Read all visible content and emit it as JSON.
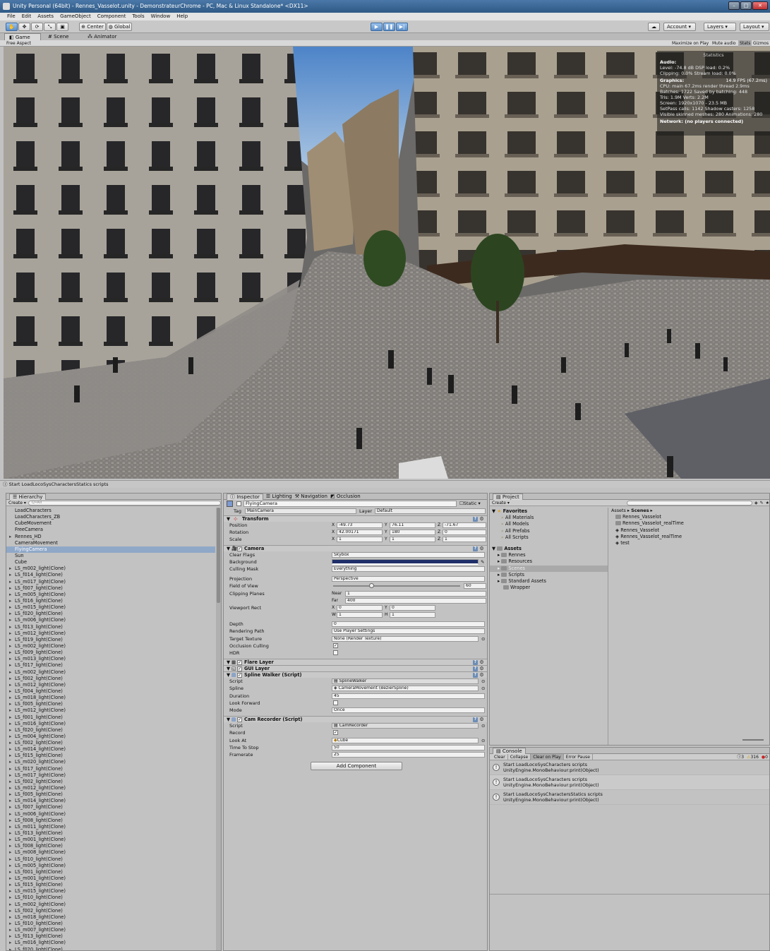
{
  "window": {
    "title": "Unity Personal (64bit) - Rennes_Vasselot.unity - DemonstrateurChrome - PC, Mac & Linux Standalone* <DX11>",
    "buttons": [
      "–",
      "□",
      "✕"
    ]
  },
  "menu": [
    "File",
    "Edit",
    "Assets",
    "GameObject",
    "Component",
    "Tools",
    "Window",
    "Help"
  ],
  "toolbar": {
    "center": "Center",
    "global": "Global",
    "account": "Account",
    "layers": "Layers",
    "layout": "Layout"
  },
  "view_tabs": {
    "game": "Game",
    "scene": "Scene",
    "animator": "Animator"
  },
  "game_bar": {
    "aspect": "Free Aspect",
    "maximize": "Maximize on Play",
    "mute": "Mute audio",
    "stats": "Stats",
    "gizmos": "Gizmos"
  },
  "stats": {
    "header": "Statistics",
    "audio_title": "Audio:",
    "audio_lines": [
      "Level: -74.8 dB        DSP load: 0.2%",
      "Clipping: 0.0%         Stream load: 0.0%"
    ],
    "graphics_title": "Graphics:",
    "fps": "14.9 FPS (67.2ms)",
    "graphics_lines": [
      "CPU: main 67.2ms  render thread 2.9ms",
      "Batches: 1722     Saved by batching: 448",
      "Tris: 1.9M           Verts: 2.2M",
      "Screen: 1920x1070 - 23.5 MB",
      "SetPass calls: 1142  Shadow casters: 1258",
      "Visible skinned meshes: 280  Animations: 280"
    ],
    "network": "Network: (no players connected)"
  },
  "status": "Start LoadLocoSysCharactersStatics scripts",
  "hierarchy": {
    "tab": "Hierarchy",
    "create": "Create",
    "search": "Q•All",
    "items": [
      "LoadCharacters",
      "LoadCharacters_ZB",
      "CubeMovement",
      "FreeCamera",
      "Rennes_HD",
      "CameraMovement",
      "FlyingCamera",
      "Sun",
      "Cube",
      "LS_m002_light(Clone)",
      "LS_f014_light(Clone)",
      "LS_m017_light(Clone)",
      "LS_f007_light(Clone)",
      "LS_m005_light(Clone)",
      "LS_f016_light(Clone)",
      "LS_m015_light(Clone)",
      "LS_f020_light(Clone)",
      "LS_m006_light(Clone)",
      "LS_f013_light(Clone)",
      "LS_m012_light(Clone)",
      "LS_f019_light(Clone)",
      "LS_m002_light(Clone)",
      "LS_f009_light(Clone)",
      "LS_m013_light(Clone)",
      "LS_f017_light(Clone)",
      "LS_m002_light(Clone)",
      "LS_f002_light(Clone)",
      "LS_m012_light(Clone)",
      "LS_f004_light(Clone)",
      "LS_m018_light(Clone)",
      "LS_f005_light(Clone)",
      "LS_m012_light(Clone)",
      "LS_f001_light(Clone)",
      "LS_m016_light(Clone)",
      "LS_f020_light(Clone)",
      "LS_m004_light(Clone)",
      "LS_f002_light(Clone)",
      "LS_m014_light(Clone)",
      "LS_f015_light(Clone)",
      "LS_m020_light(Clone)",
      "LS_f017_light(Clone)",
      "LS_m017_light(Clone)",
      "LS_f002_light(Clone)",
      "LS_m012_light(Clone)",
      "LS_f005_light(Clone)",
      "LS_m014_light(Clone)",
      "LS_f007_light(Clone)",
      "LS_m006_light(Clone)",
      "LS_f008_light(Clone)",
      "LS_m011_light(Clone)",
      "LS_f013_light(Clone)",
      "LS_m001_light(Clone)",
      "LS_f008_light(Clone)",
      "LS_m008_light(Clone)",
      "LS_f010_light(Clone)",
      "LS_m005_light(Clone)",
      "LS_f001_light(Clone)",
      "LS_m001_light(Clone)",
      "LS_f015_light(Clone)",
      "LS_m015_light(Clone)",
      "LS_f010_light(Clone)",
      "LS_m002_light(Clone)",
      "LS_f002_light(Clone)",
      "LS_m018_light(Clone)",
      "LS_f010_light(Clone)",
      "LS_m007_light(Clone)",
      "LS_f013_light(Clone)",
      "LS_m016_light(Clone)",
      "LS_f020_light(Clone)"
    ]
  },
  "inspector": {
    "tabs": [
      "Inspector",
      "Lighting",
      "Navigation",
      "Occlusion"
    ],
    "object_name": "FlyingCamera",
    "static": "Static",
    "tag_label": "Tag",
    "tag": "MainCamera",
    "layer_label": "Layer",
    "layer": "Default",
    "transform": {
      "title": "Transform",
      "position_label": "Position",
      "px": "-49.73",
      "py": "76.11",
      "pz": "-71.67",
      "rotation_label": "Rotation",
      "rx": "42.00171",
      "ry": "180",
      "rz": "0",
      "scale_label": "Scale",
      "sx": "1",
      "sy": "1",
      "sz": "1"
    },
    "camera": {
      "title": "Camera",
      "clear_flags_label": "Clear Flags",
      "clear_flags": "Skybox",
      "background_label": "Background",
      "culling_label": "Culling Mask",
      "culling": "Everything",
      "projection_label": "Projection",
      "projection": "Perspective",
      "fov_label": "Field of View",
      "fov": "60",
      "fov_fraction": 0.3,
      "clipping_label": "Clipping Planes",
      "near_label": "Near",
      "near": "1",
      "far_label": "Far",
      "far": "400",
      "viewport_label": "Viewport Rect",
      "vx": "0",
      "vy": "0",
      "vw": "1",
      "vh": "1",
      "depth_label": "Depth",
      "depth": "0",
      "rendering_label": "Rendering Path",
      "rendering": "Use Player Settings",
      "target_label": "Target Texture",
      "target": "None (Render Texture)",
      "occlusion_label": "Occlusion Culling",
      "hdr_label": "HDR"
    },
    "flare": "Flare Layer",
    "gui": "GUI Layer",
    "spline": {
      "title": "Spline Walker (Script)",
      "script_label": "Script",
      "script": "SplineWalker",
      "spline_label": "Spline",
      "spline": "CameraMovement (BezierSpline)",
      "duration_label": "Duration",
      "duration": "45",
      "look_label": "Look Forward",
      "mode_label": "Mode",
      "mode": "Once"
    },
    "recorder": {
      "title": "Cam Recorder (Script)",
      "script_label": "Script",
      "script": "CamRecorder",
      "record_label": "Record",
      "lookat_label": "Look At",
      "lookat": "Cube",
      "time_label": "Time To Stop",
      "time": "50",
      "framerate_label": "Framerate",
      "framerate": "25"
    },
    "add_component": "Add Component"
  },
  "project": {
    "tab": "Project",
    "create": "Create",
    "favorites": "Favorites",
    "fav_items": [
      "All Materials",
      "All Models",
      "All Prefabs",
      "All Scripts"
    ],
    "assets": "Assets",
    "asset_items": [
      "Rennes",
      "Resources",
      "Scenes",
      "Scripts",
      "Standard Assets",
      "Wrapper"
    ],
    "breadcrumb_assets": "Assets",
    "breadcrumb_scenes": "Scenes",
    "files": [
      "Rennes_Vasselot",
      "Rennes_Vasselot_realTime",
      "Rennes_Vasselot",
      "Rennes_Vasselot_realTime",
      "test"
    ]
  },
  "console": {
    "tab": "Console",
    "clear": "Clear",
    "collapse": "Collapse",
    "clear_on_play": "Clear on Play",
    "error_pause": "Error Pause",
    "counts": {
      "info": "3",
      "warn": "316",
      "err": "0"
    },
    "entries": [
      {
        "line1": "Start LoadLocoSysCharacters scripts",
        "line2": "UnityEngine.MonoBehaviour:print(Object)"
      },
      {
        "line1": "Start LoadLocoSysCharacters scripts",
        "line2": "UnityEngine.MonoBehaviour:print(Object)"
      },
      {
        "line1": "Start LoadLocoSysCharactersStatics scripts",
        "line2": "UnityEngine.MonoBehaviour:print(Object)"
      }
    ]
  },
  "colors": {
    "selection": "#8fa8c8",
    "play_blue": "#3a6aa0",
    "camera_bg": "#1f2f6a"
  }
}
